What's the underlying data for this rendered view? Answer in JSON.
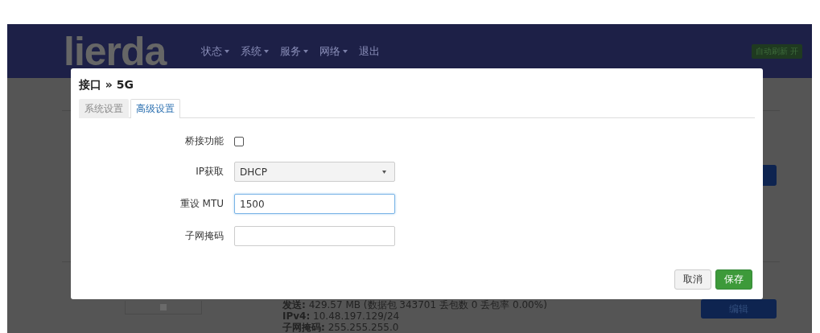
{
  "navbar": {
    "logo": "lierda",
    "menu": [
      {
        "label": "状态",
        "dropdown": true
      },
      {
        "label": "系统",
        "dropdown": true
      },
      {
        "label": "服务",
        "dropdown": true
      },
      {
        "label": "网络",
        "dropdown": true
      },
      {
        "label": "退出",
        "dropdown": false
      }
    ],
    "auto_refresh": "自动刷新 开"
  },
  "page": {
    "details": [
      "**发送:** 429.57 MB (数据包 343701 丢包数 0 丢包率 0.00%)",
      "**IPv4:** 10.48.197.129/24",
      "**子网掩码:** 255.255.255.0"
    ],
    "edit_button": "编辑"
  },
  "dialog": {
    "title": "接口 » 5G",
    "tabs": [
      {
        "label": "系统设置",
        "selected": false
      },
      {
        "label": "高级设置",
        "selected": true
      }
    ],
    "fields": [
      {
        "kind": "checkbox",
        "label": "桥接功能",
        "checked": false
      },
      {
        "kind": "select",
        "label": "IP获取",
        "value": "DHCP"
      },
      {
        "kind": "text",
        "label": "重设 MTU",
        "value": "1500",
        "focused": true
      },
      {
        "kind": "text",
        "label": "子网掩码",
        "focused": false
      }
    ],
    "buttons": [
      {
        "kind": "cancel",
        "label": "取消"
      },
      {
        "kind": "save",
        "label": "保存"
      }
    ]
  }
}
